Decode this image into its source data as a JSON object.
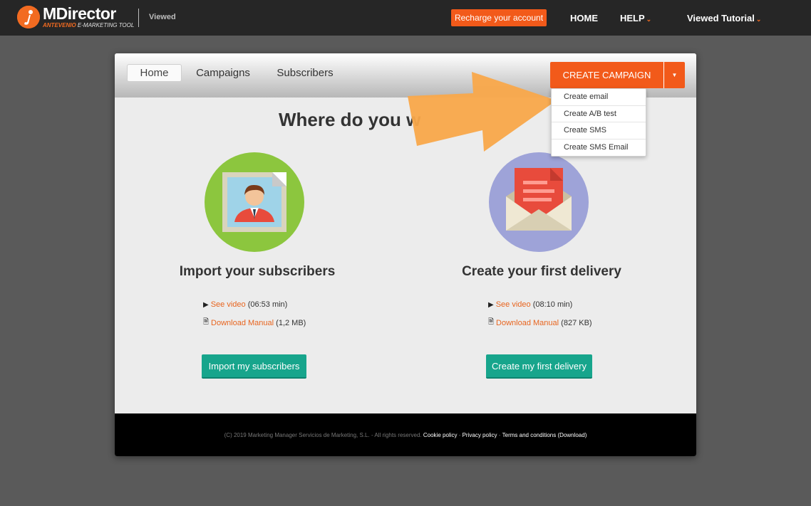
{
  "topbar": {
    "logo_title": "MDirector",
    "logo_sub_brand": "ANTEVENIO",
    "logo_sub_rest": "E-MARKETING TOOL",
    "section_label": "Viewed",
    "recharge_label": "Recharge your account",
    "nav": [
      {
        "label": "HOME"
      },
      {
        "label": "HELP",
        "chevron": "⌄"
      },
      {
        "label": "Viewed Tutorial",
        "chevron": "⌄"
      }
    ]
  },
  "tabs": [
    {
      "label": "Home",
      "active": true
    },
    {
      "label": "Campaigns"
    },
    {
      "label": "Subscribers"
    }
  ],
  "create_button": {
    "label": "CREATE CAMPAIGN",
    "caret": "▼"
  },
  "dropdown": {
    "items": [
      {
        "label": "Create email"
      },
      {
        "label": "Create A/B test"
      },
      {
        "label": "Create SMS"
      },
      {
        "label": "Create SMS Email"
      }
    ]
  },
  "main": {
    "heading": "Where do you w",
    "columns": [
      {
        "title": "Import your subscribers",
        "video_link": "See video",
        "video_meta": "(06:53 min)",
        "manual_link": "Download Manual",
        "manual_meta": "(1,2 MB)",
        "cta": "Import my subscribers",
        "circle_color": "#8cc63e"
      },
      {
        "title": "Create your first delivery",
        "video_link": "See video",
        "video_meta": "(08:10 min)",
        "manual_link": "Download Manual",
        "manual_meta": "(827 KB)",
        "cta": "Create my first delivery",
        "circle_color": "#9ea3d8"
      }
    ]
  },
  "footer": {
    "copyright": "(C) 2019 Marketing Manager Servicios de Marketing, S.L. - All rights reserved.",
    "cookie": "Cookie policy",
    "sep": "-",
    "privacy": "Privacy policy",
    "terms": "Terms and conditions (Download)"
  },
  "colors": {
    "accent": "#f25a1a",
    "teal": "#17a58c",
    "arrow": "#f9a84a"
  }
}
